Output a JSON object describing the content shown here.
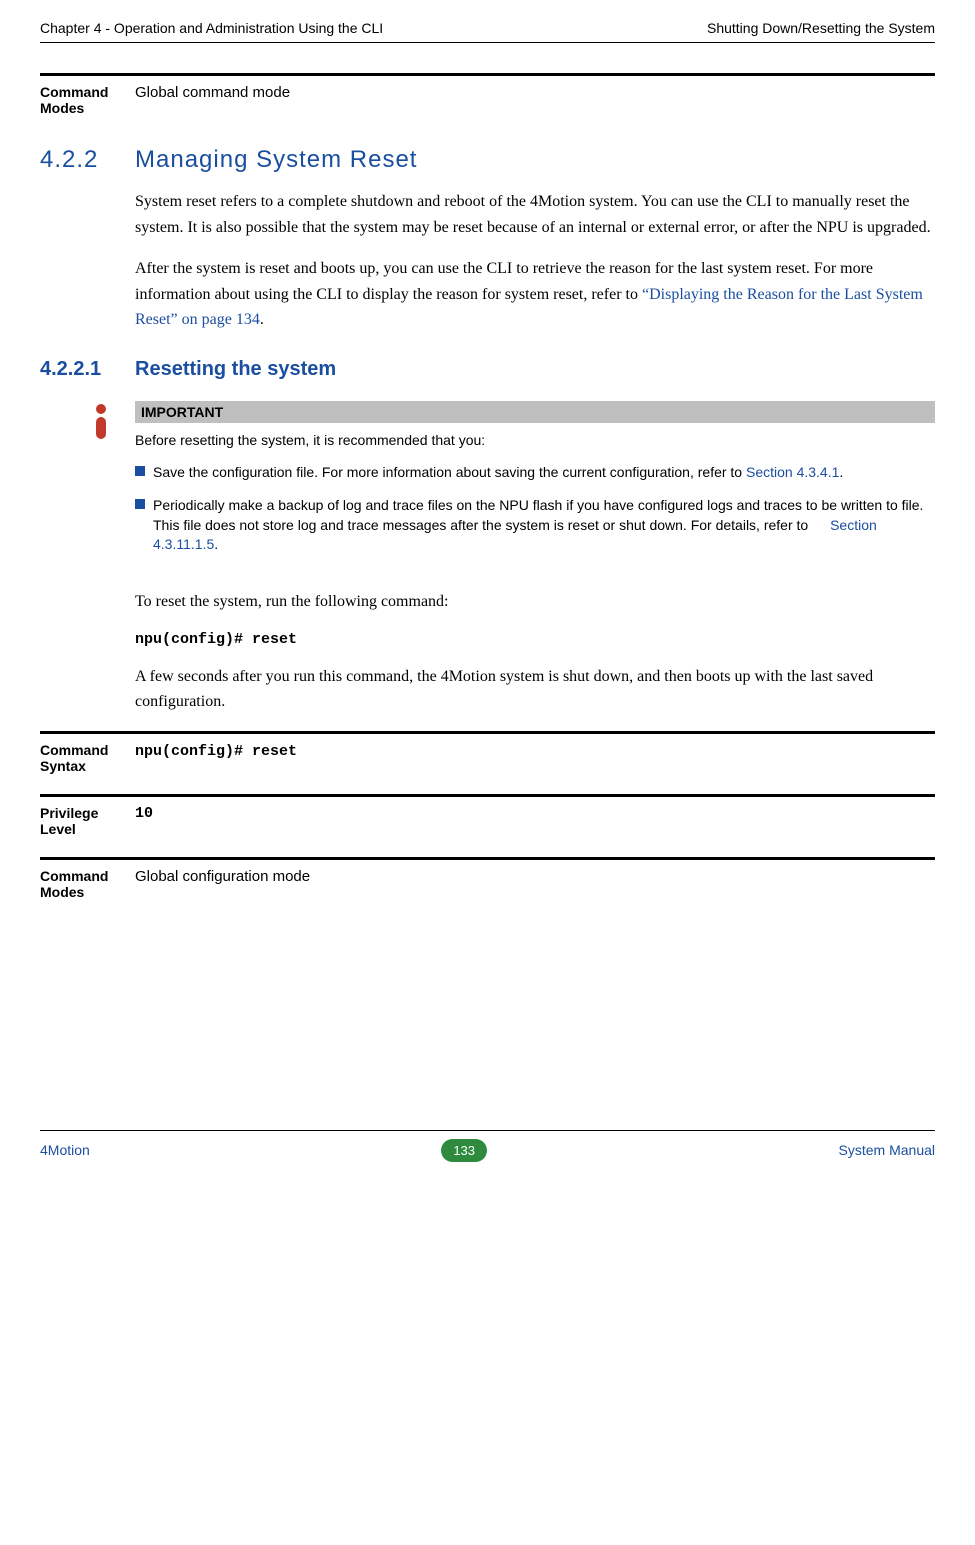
{
  "header": {
    "left": "Chapter 4 - Operation and Administration Using the CLI",
    "right": "Shutting Down/Resetting the System"
  },
  "block_modes_top": {
    "label": "Command Modes",
    "value": "Global command mode"
  },
  "h2": {
    "num": "4.2.2",
    "title": "Managing System Reset"
  },
  "para1": "System reset refers to a complete shutdown and reboot of the 4Motion system. You can use the CLI to manually reset the system. It is also possible that the system may be reset because of an internal or external error, or after the NPU is upgraded.",
  "para2_a": "After the system is reset and boots up, you can use the CLI to retrieve the reason for the last system reset. For more information about using the CLI to display the reason for system reset, refer to ",
  "para2_link": "“Displaying the Reason for the Last System Reset” on page 134",
  "para2_b": ".",
  "h3": {
    "num": "4.2.2.1",
    "title": "Resetting the system"
  },
  "important": {
    "header": "IMPORTANT",
    "intro": "Before resetting the system, it is recommended that you:",
    "b1_a": "Save the configuration file. For more information about saving the current configuration, refer to ",
    "b1_link": "Section 4.3.4.1",
    "b1_b": ".",
    "b2_a": "Periodically make a backup of log and trace files on the NPU flash if you have configured logs and traces to be written to file. This file does not store log and trace messages after the system is reset or shut down. For details, refer to ",
    "b2_link": "Section 4.3.11.1.5",
    "b2_b": "."
  },
  "para3": "To reset the system, run the following command:",
  "cmd": "npu(config)# reset",
  "para4": "A few seconds after you run this command, the 4Motion system is shut down, and then boots up with the last saved configuration.",
  "block_syntax": {
    "label": "Command Syntax",
    "value_pre": "npu",
    "value_post": "(config)# reset"
  },
  "block_priv": {
    "label": "Privilege Level",
    "value": "10"
  },
  "block_modes_bot": {
    "label": "Command Modes",
    "value": "Global configuration mode"
  },
  "footer": {
    "left": "4Motion",
    "page": "133",
    "right": "System Manual"
  }
}
